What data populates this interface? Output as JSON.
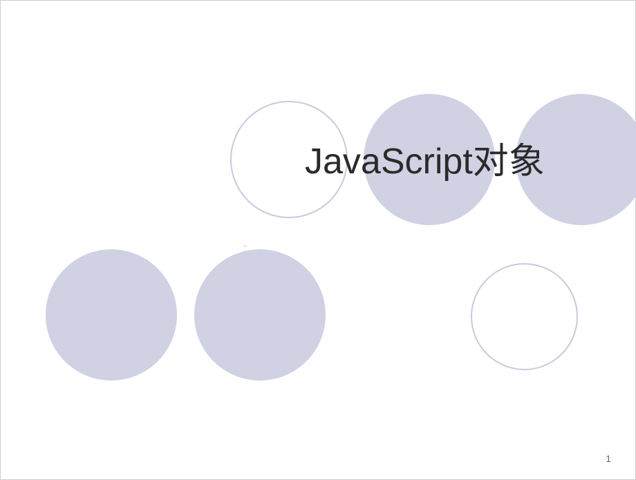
{
  "slide": {
    "title": "JavaScript对象",
    "centerMark": ".",
    "pageNumber": "1"
  }
}
